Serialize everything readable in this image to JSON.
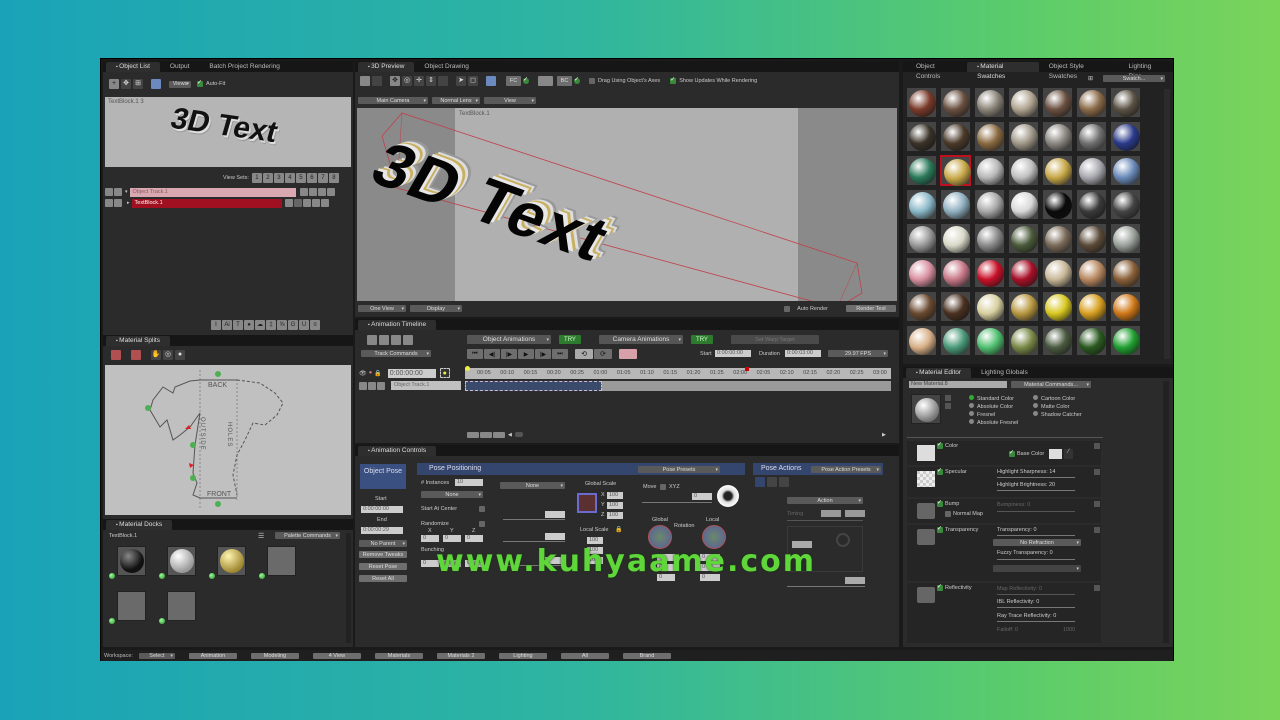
{
  "object_list_panel": {
    "tabs": [
      "Object List",
      "Output",
      "Batch Project Rendering"
    ],
    "active_tab": "Object List",
    "views_label": "Views",
    "autofit_label": "Auto-Fit",
    "preview_label": "TextBlock.1 3",
    "preview_text": "3D Text",
    "view_sets_label": "View Sets:",
    "view_sets": [
      "1",
      "2",
      "3",
      "4",
      "5",
      "6",
      "7",
      "8"
    ],
    "tracks": [
      {
        "name": "Object Track.1",
        "selected": false
      },
      {
        "name": "TextBlock.1",
        "selected": true
      }
    ],
    "bottom_tools": [
      "I",
      "Ai",
      "T",
      "●",
      "☁",
      "‡",
      "⅝",
      "G",
      "U",
      "≡"
    ]
  },
  "material_splits_panel": {
    "tab": "Material Splits",
    "labels": {
      "back": "BACK",
      "outside": "OUTSIDE",
      "holes": "HOLES",
      "front": "FRONT"
    }
  },
  "material_docks_panel": {
    "tab": "Material Docks",
    "object": "TextBlock.1",
    "palette_commands": "Palette Commands",
    "docks": [
      "black-chrome",
      "silver",
      "gold",
      "empty",
      "empty",
      "empty"
    ]
  },
  "preview_panel": {
    "tabs": [
      "3D Preview",
      "Object Drawing"
    ],
    "active_tab": "3D Preview",
    "toolbar": {
      "fc_label": "FC",
      "bc_label": "BC",
      "drag_axes_label": "Drag Using Object's Axes",
      "drag_axes_checked": false,
      "show_updates_label": "Show Updates While Rendering",
      "show_updates_checked": true
    },
    "camera": "Main Camera",
    "lens": "Normal Lens",
    "view": "View",
    "object_label": "TextBlock.1",
    "render_text": "3D Text",
    "one_view": "One View",
    "display": "Display",
    "auto_render_label": "Auto Render",
    "render_test": "Render Test"
  },
  "timeline_panel": {
    "tab": "Animation Timeline",
    "track_commands": "Track Commands",
    "object_animations": "Object Animations",
    "camera_animations": "Camera Animations",
    "try_label": "TRY",
    "set_warp_target": "Set Warp Target",
    "start_label": "Start",
    "start_value": "0:00:00:00",
    "duration_label": "Duration",
    "duration_value": "0:00:03:00",
    "fps": "29.97 FPS",
    "current_time": "0:00:00:00",
    "ticks": [
      "00:05",
      "00:10",
      "00:15",
      "00:20",
      "00:25",
      "01:00",
      "01:05",
      "01:10",
      "01:15",
      "01:20",
      "01:25",
      "02:00",
      "02:05",
      "02:10",
      "02:15",
      "02:20",
      "02:25",
      "03:00"
    ],
    "track_name": "Object Track.1"
  },
  "animation_controls_panel": {
    "tab": "Animation Controls",
    "object_pose": "Object Pose",
    "start_label": "Start",
    "start_value": "0:00:00:00",
    "end_label": "End",
    "end_value": "0:00:00:29",
    "no_parent": "No Parent",
    "remove_tweaks": "Remove Tweaks",
    "reset_pose": "Reset Pose",
    "reset_all": "Reset All",
    "pose_positioning": "Pose Positioning",
    "pose_presets": "Pose Presets",
    "instances_label": "# Instances",
    "instances_value": "10",
    "none1": "None",
    "none2": "None",
    "start_at_center": "Start At Center",
    "randomize": "Randomize",
    "bunching": "Bunching",
    "xyz": [
      "X",
      "Y",
      "Z"
    ],
    "rand_values": [
      "0",
      "0",
      "0"
    ],
    "bunch_values": [
      "0",
      "0",
      "0"
    ],
    "global_scale": "Global Scale",
    "global_scale_values": [
      "100",
      "100",
      "100"
    ],
    "local_scale": "Local Scale",
    "local_scale_values": [
      "100",
      "100",
      "100"
    ],
    "move_label": "Move",
    "move_xyz": "XYZ",
    "move_value": "0",
    "global_label": "Global",
    "rotation_label": "Rotation",
    "local_label": "Local",
    "rot_global": [
      "0",
      "0",
      "0"
    ],
    "rot_local": [
      "0",
      "0",
      "0"
    ],
    "pose_actions": "Pose Actions",
    "pose_action_presets": "Pose Action Presets",
    "action": "Action",
    "timing": "Timing"
  },
  "swatches_panel": {
    "tabs": [
      "Object Controls",
      "Material Swatches",
      "Object Style Swatches",
      "Lighting Rigs"
    ],
    "active_tab": "Material Swatches",
    "swatch_dropdown": "Swatch...",
    "selected_index": 15,
    "swatches": [
      "#7a3a2a",
      "#6a5040",
      "#8a8478",
      "#b0a490",
      "#6a5040",
      "#8a6a48",
      "#5a5244",
      "#3a3228",
      "#4a3a2a",
      "#8a6a40",
      "#a09888",
      "#8a8680",
      "#707070",
      "#2a3a8a",
      "#2a7a5a",
      "#c8a848",
      "#b8b8b8",
      "#c0c0c0",
      "#c8a848",
      "#a8a8b0",
      "#6a8ab8",
      "#8ab8c8",
      "#90b0c0",
      "#a8a8a8",
      "#d8d8d8",
      "#0a0a0a",
      "#3a3a3a",
      "#444444",
      "#9a9a9a",
      "#d8d8c8",
      "#8a8a8a",
      "#4a5a3a",
      "#7a6a58",
      "#5a4a38",
      "#9aa09a",
      "#d890a0",
      "#c87888",
      "#c81028",
      "#a81028",
      "#c8b898",
      "#b88860",
      "#8a6038",
      "#6a4a30",
      "#4a3020",
      "#d8d0a0",
      "#b89840",
      "#d8c820",
      "#d8a020",
      "#d07818",
      "#d8b088",
      "#4a9a7a",
      "#50c070",
      "#7a8a48",
      "#4a5a40",
      "#2a5a20",
      "#20a030"
    ]
  },
  "material_editor_panel": {
    "tabs": [
      "Material Editor",
      "Lighting Globals"
    ],
    "active_tab": "Material Editor",
    "material_name": "New Material.8",
    "material_commands": "Material Commands...",
    "color_modes": [
      "Standard Color",
      "Absolute Color",
      "Fresnel",
      "Absolute Fresnel",
      "Cartoon Color",
      "Matte Color",
      "Shadow Catcher"
    ],
    "selected_mode": "Standard Color",
    "sections": {
      "color": "Color",
      "base_color": "Base Color",
      "specular": "Specular",
      "highlight_sharpness": "Highlight Sharpness: 14",
      "highlight_brightness": "Highlight Brightness: 20",
      "bump": "Bump",
      "bumpiness": "Bumpiness: 0",
      "normal_map": "Normal Map",
      "transparency": "Transparency",
      "transparency_value": "Transparency: 0",
      "no_refraction": "No Refraction",
      "fuzzy_transparency": "Fuzzy Transparency: 0",
      "reflectivity": "Reflectivity",
      "map_reflectivity": "Map Reflectivity: 0",
      "ibl_reflectivity": "IBL Reflectivity: 0",
      "ray_trace_reflectivity": "Ray Trace Reflectivity: 0",
      "falloff": "Falloff: 0",
      "falloff_max": "1000"
    }
  },
  "workspace_bar": {
    "label": "Workspace:",
    "current": "Select",
    "buttons": [
      "Animation",
      "Modeling",
      "4 View",
      "Materials",
      "Materials 2",
      "Lighting",
      "All",
      "Brand"
    ]
  },
  "watermark": "www.kuhyaame.com"
}
